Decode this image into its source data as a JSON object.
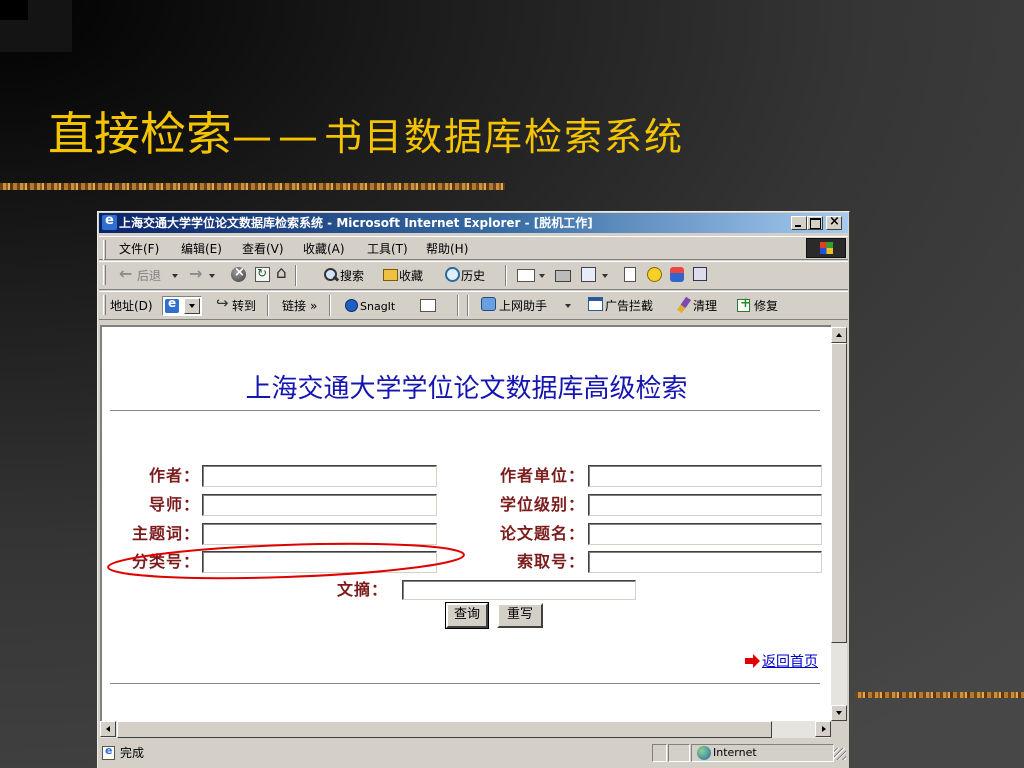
{
  "slide": {
    "title_main": "直接检索",
    "title_dash": "——",
    "title_sub": "书目数据库检索系统",
    "colors": {
      "title": "#f5c400",
      "band": "#c8903c",
      "annotation": "#e00000",
      "background": "#3a3a3a"
    }
  },
  "browser": {
    "window_title": "上海交通大学学位论文数据库检索系统 - Microsoft Internet Explorer - [脱机工作]",
    "menu": [
      "文件(F)",
      "编辑(E)",
      "查看(V)",
      "收藏(A)",
      "工具(T)",
      "帮助(H)"
    ],
    "toolbar": {
      "back": "后退",
      "search": "搜索",
      "favorites": "收藏",
      "history": "历史"
    },
    "address_bar": {
      "label": "地址(D)",
      "go": "转到",
      "links": "链接",
      "more": "»",
      "snagit": "SnagIt",
      "assistant": "上网助手",
      "popup_blocker": "广告拦截",
      "clean": "清理",
      "repair": "修复"
    },
    "status": {
      "text": "完成",
      "zone": "Internet"
    },
    "icons": {
      "title": "ie-icon",
      "back": "back-arrow-icon",
      "forward": "forward-arrow-icon",
      "stop": "stop-icon",
      "refresh": "refresh-icon",
      "home": "home-icon",
      "search": "search-icon",
      "favorites": "favorites-folder-icon",
      "history": "history-icon",
      "mail": "mail-icon",
      "print": "print-icon",
      "edit": "edit-icon",
      "zone": "globe-icon"
    },
    "colors": {
      "titlebar_start": "#0a246a",
      "titlebar_end": "#a6caf0",
      "chrome": "#d4d0c8"
    }
  },
  "page": {
    "heading": "上海交通大学学位论文数据库高级检索",
    "fields_left": [
      "作者：",
      "导师：",
      "主题词：",
      "分类号："
    ],
    "fields_right": [
      "作者单位：",
      "学位级别：",
      "论文题名：",
      "索取号："
    ],
    "abstract_label": "文摘：",
    "buttons": {
      "search": "查询",
      "reset": "重写"
    },
    "back_link": "返回首页",
    "colors": {
      "heading": "#1515b0",
      "label": "#7b1c1c",
      "link": "#0000cc"
    }
  }
}
